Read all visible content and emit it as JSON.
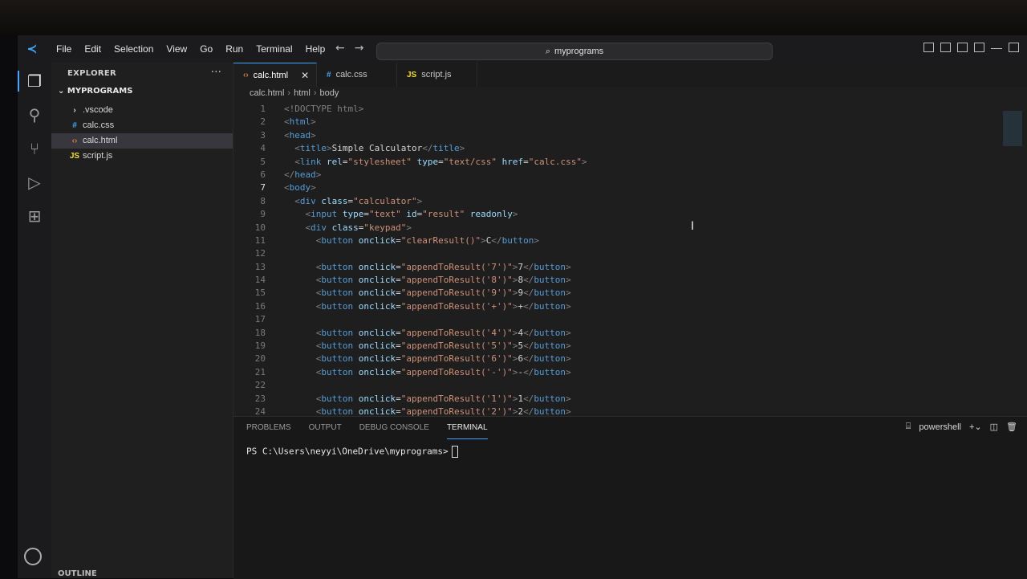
{
  "menu": [
    "File",
    "Edit",
    "Selection",
    "View",
    "Go",
    "Run",
    "Terminal",
    "Help"
  ],
  "search": {
    "label": "myprograms"
  },
  "sidebar": {
    "header": "EXPLORER",
    "folder": "MYPROGRAMS",
    "items": [
      {
        "name": ".vscode",
        "type": "folder"
      },
      {
        "name": "calc.css",
        "type": "css"
      },
      {
        "name": "calc.html",
        "type": "html"
      },
      {
        "name": "script.js",
        "type": "js"
      }
    ],
    "outline": "OUTLINE"
  },
  "tabs": [
    {
      "label": "calc.html",
      "active": true
    },
    {
      "label": "calc.css",
      "active": false
    },
    {
      "label": "script.js",
      "active": false
    }
  ],
  "breadcrumb": [
    "calc.html",
    "html",
    "body"
  ],
  "code": [
    "<!DOCTYPE html>",
    "<html>",
    "<head>",
    "  <title>Simple Calculator</title>",
    "  <link rel=\"stylesheet\" type=\"text/css\" href=\"calc.css\">",
    "</head>",
    "<body>",
    "  <div class=\"calculator\">",
    "    <input type=\"text\" id=\"result\" readonly>",
    "    <div class=\"keypad\">",
    "      <button onclick=\"clearResult()\">C</button>",
    "",
    "      <button onclick=\"appendToResult('7')\">7</button>",
    "      <button onclick=\"appendToResult('8')\">8</button>",
    "      <button onclick=\"appendToResult('9')\">9</button>",
    "      <button onclick=\"appendToResult('+')\">+</button>",
    "",
    "      <button onclick=\"appendToResult('4')\">4</button>",
    "      <button onclick=\"appendToResult('5')\">5</button>",
    "      <button onclick=\"appendToResult('6')\">6</button>",
    "      <button onclick=\"appendToResult('-')\">-</button>",
    "",
    "      <button onclick=\"appendToResult('1')\">1</button>",
    "      <button onclick=\"appendToResult('2')\">2</button>"
  ],
  "current_line": 7,
  "panel": {
    "tabs": [
      "PROBLEMS",
      "OUTPUT",
      "DEBUG CONSOLE",
      "TERMINAL"
    ],
    "active_tab": "TERMINAL",
    "shell": "powershell",
    "prompt": "PS C:\\Users\\neyyi\\OneDrive\\myprograms>"
  },
  "colors": {
    "accent": "#3ea6ff",
    "tag": "#569cd6",
    "attr": "#9cdcfe",
    "string": "#ce9178"
  }
}
